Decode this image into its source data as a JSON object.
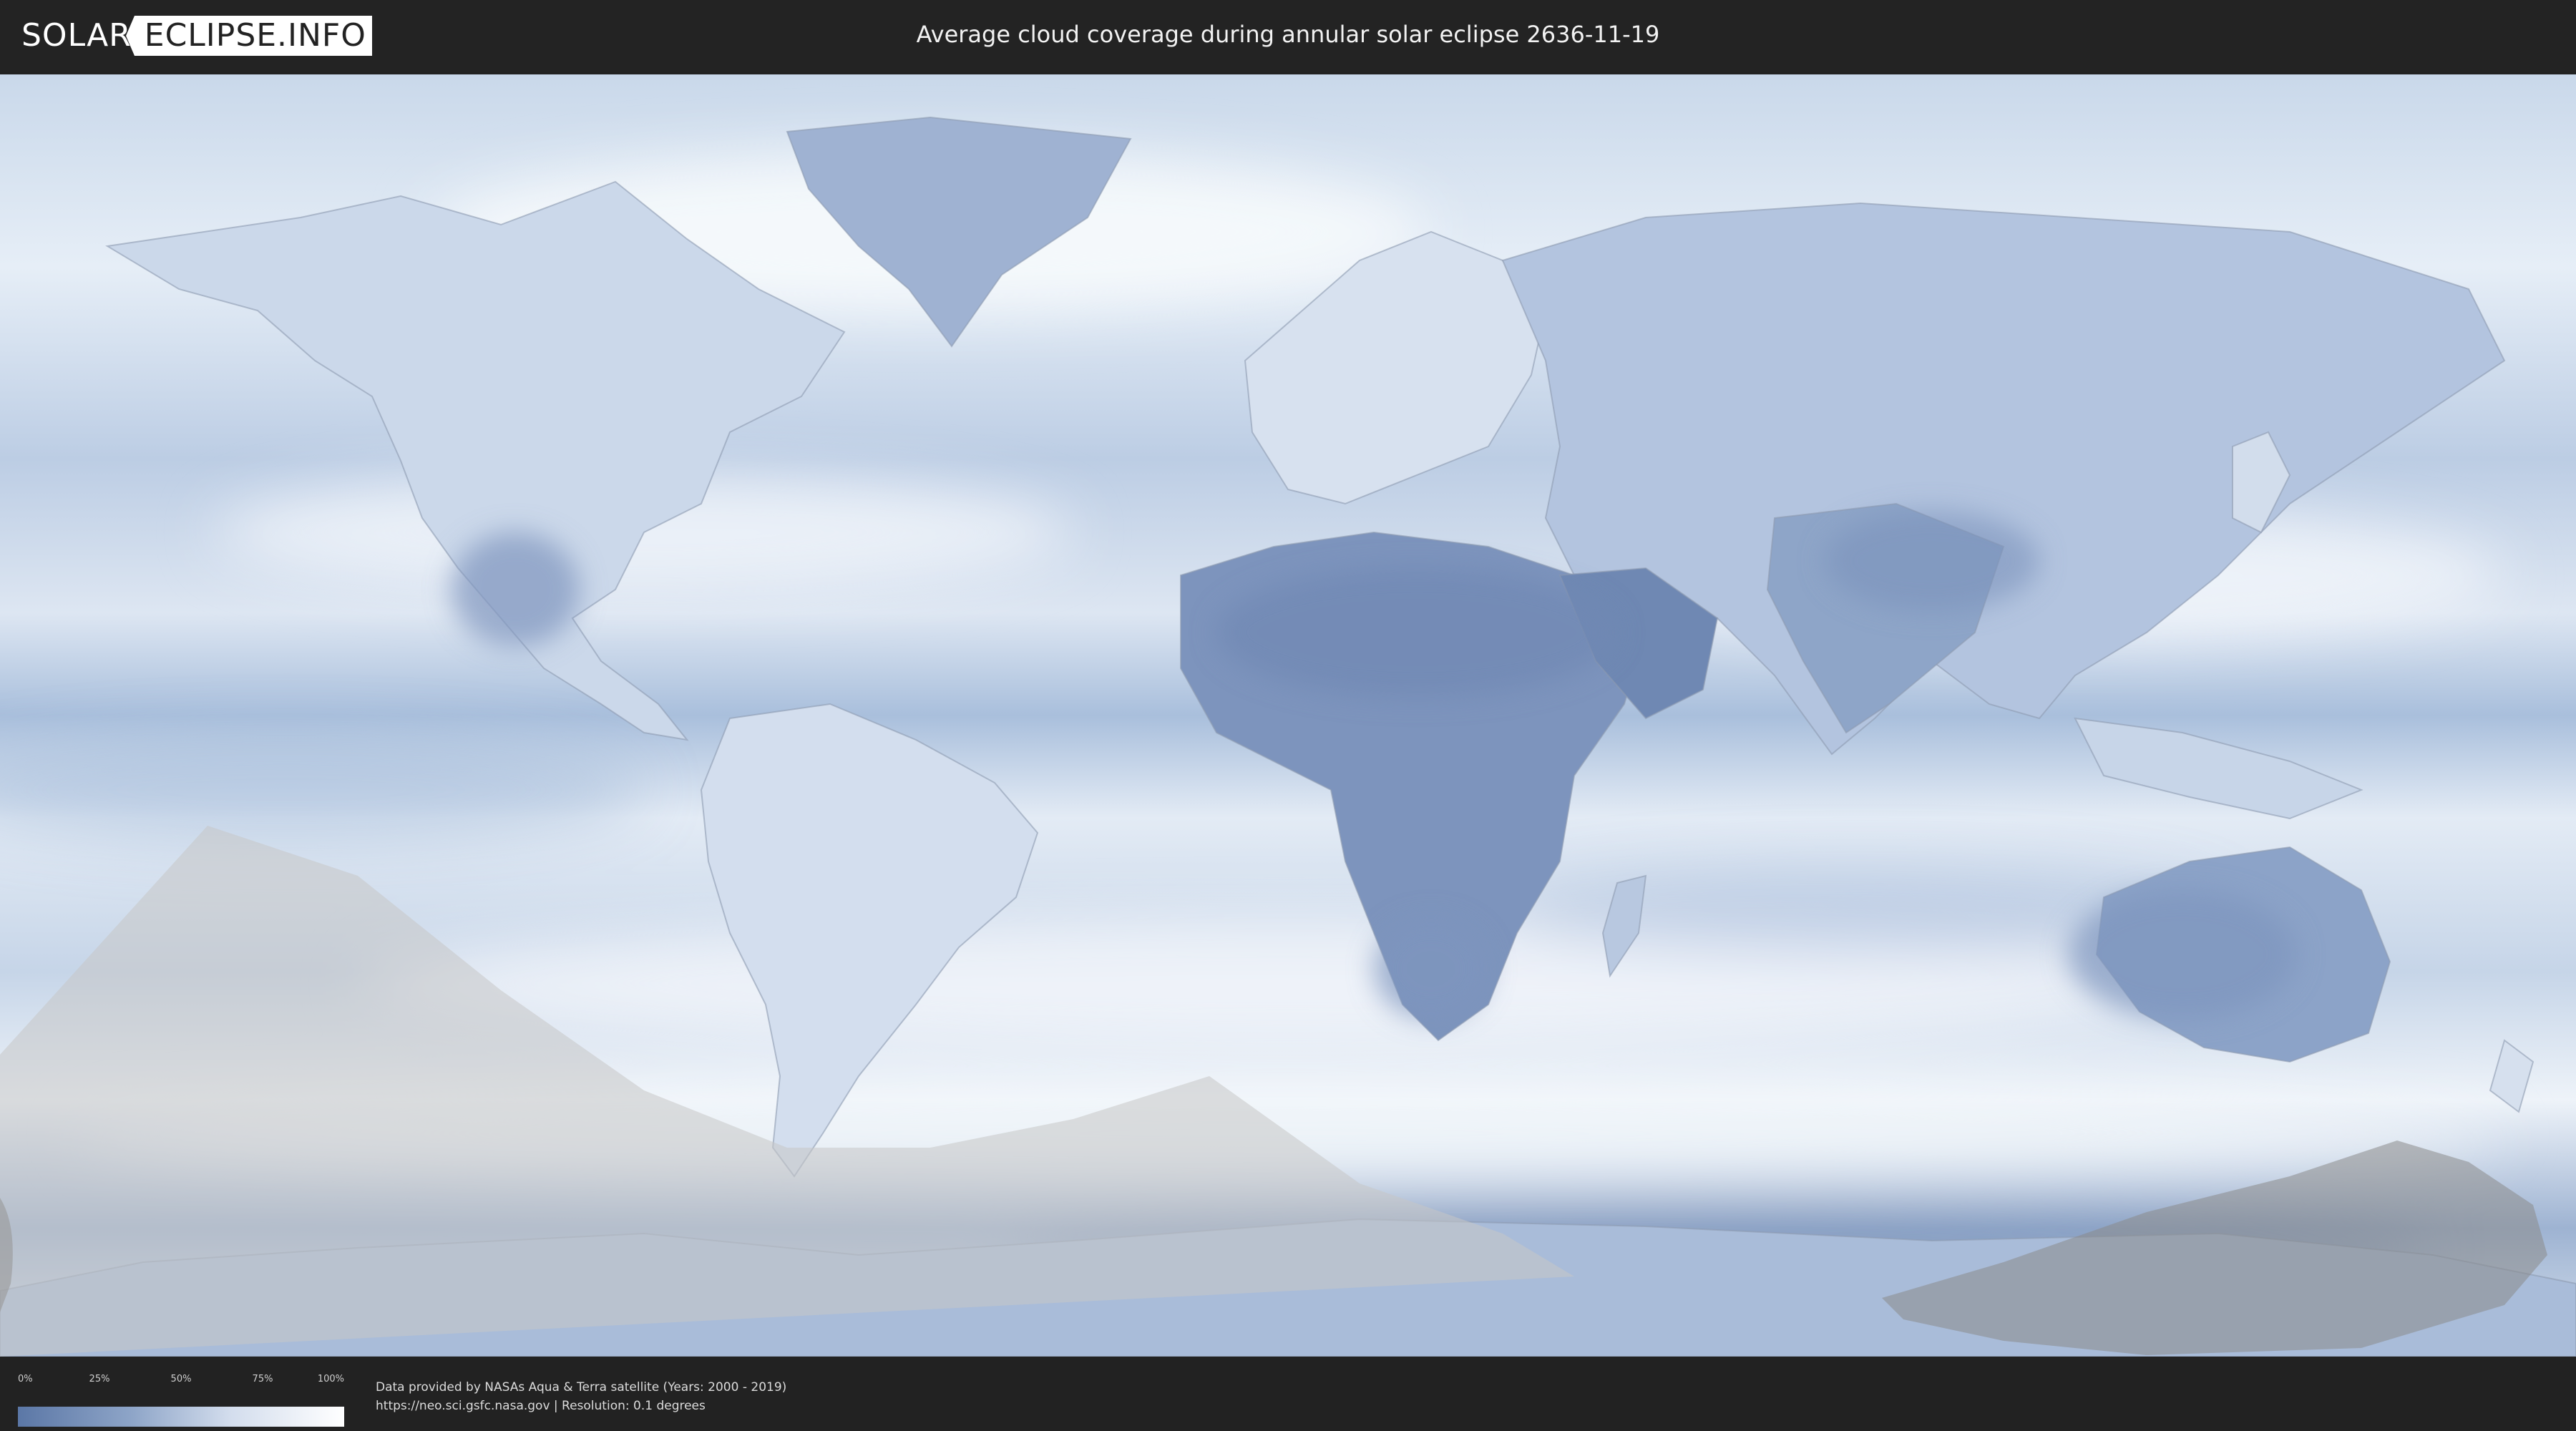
{
  "header": {
    "logo_left": "SOLAR",
    "logo_right": "ECLIPSE.INFO",
    "title": "Average cloud coverage during annular solar eclipse 2636-11-19"
  },
  "legend": {
    "ticks": [
      "0%",
      "25%",
      "50%",
      "75%",
      "100%"
    ],
    "colors": {
      "low": "#5b77a6",
      "mid": "#8ea5c8",
      "high": "#ffffff"
    }
  },
  "credits": {
    "line1": "Data provided by NASAs Aqua & Terra satellite (Years: 2000 - 2019)",
    "line2": "https://neo.sci.gsfc.nasa.gov | Resolution: 0.1 degrees"
  },
  "map": {
    "projection": "equirectangular",
    "layers": [
      "cloud-coverage",
      "country-borders",
      "eclipse-visibility-overlay"
    ],
    "colors": {
      "clear_sky": "#6f88b3",
      "cloudy": "#f4f7fb",
      "overlay": "#cccccc"
    }
  }
}
